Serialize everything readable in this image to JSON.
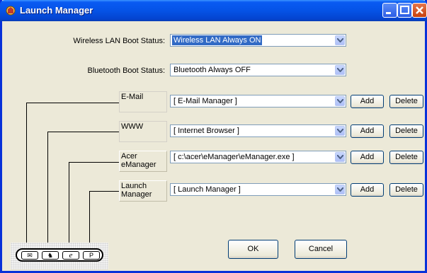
{
  "window": {
    "title": "Launch Manager"
  },
  "wireless": {
    "label": "Wireless LAN Boot Status:",
    "value": "Wireless LAN Always ON"
  },
  "bluetooth": {
    "label": "Bluetooth Boot Status:",
    "value": "Bluetooth Always OFF"
  },
  "programs": [
    {
      "name": "E-Mail",
      "value": "[ E-Mail Manager ]",
      "add": "Add",
      "delete": "Delete"
    },
    {
      "name": "WWW",
      "value": "[ Internet Browser ]",
      "add": "Add",
      "delete": "Delete"
    },
    {
      "name": "Acer eManager",
      "value": "[ c:\\acer\\eManager\\eManager.exe ]",
      "add": "Add",
      "delete": "Delete"
    },
    {
      "name": "Launch Manager",
      "value": "[ Launch Manager ]",
      "add": "Add",
      "delete": "Delete"
    }
  ],
  "keys": [
    {
      "icon": "mail-icon",
      "glyph": "✉"
    },
    {
      "icon": "www-icon",
      "glyph": "♞"
    },
    {
      "icon": "e-icon",
      "glyph": "e"
    },
    {
      "icon": "p-icon",
      "glyph": "P"
    }
  ],
  "buttons": {
    "ok": "OK",
    "cancel": "Cancel"
  }
}
